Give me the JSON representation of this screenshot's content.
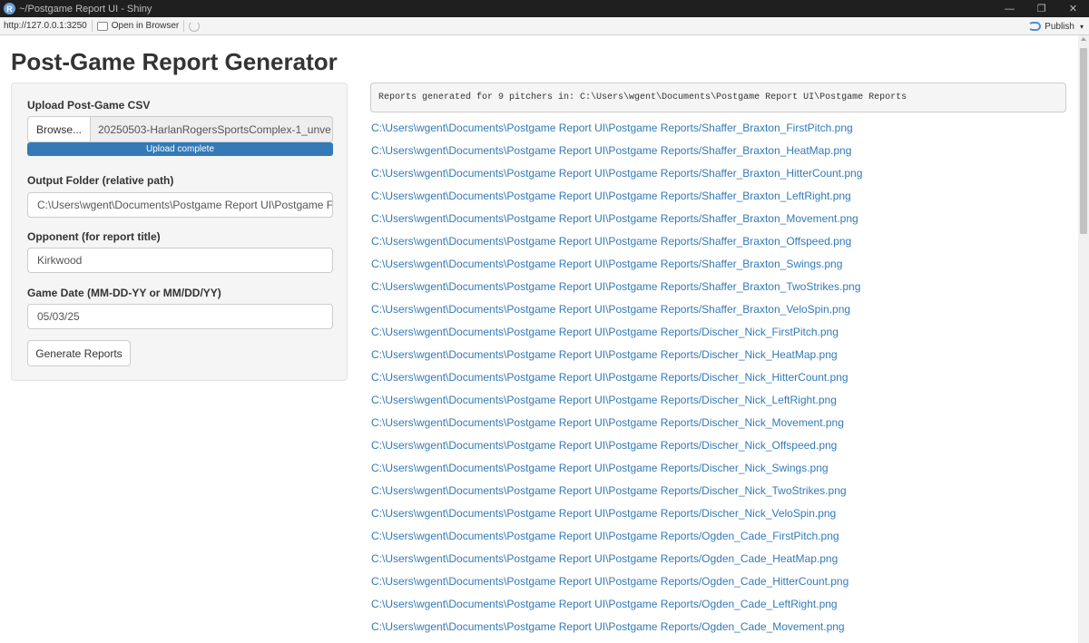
{
  "window": {
    "app_icon_letter": "R",
    "title": "~/Postgame Report UI - Shiny",
    "controls": [
      "—",
      "❐",
      "✕"
    ]
  },
  "toolbar": {
    "url": "http://127.0.0.1:3250",
    "open_in_browser": "Open in Browser",
    "publish": "Publish",
    "publish_caret": "▾"
  },
  "page": {
    "title": "Post-Game Report Generator"
  },
  "sidebar": {
    "upload_label": "Upload Post-Game CSV",
    "browse_label": "Browse...",
    "file_name": "20250503-HarlanRogersSportsComplex-1_unve",
    "upload_progress_text": "Upload complete",
    "upload_progress": 1.0,
    "output_label": "Output Folder (relative path)",
    "output_value": "C:\\Users\\wgent\\Documents\\Postgame Report UI\\Postgame F",
    "opponent_label": "Opponent (for report title)",
    "opponent_value": "Kirkwood",
    "date_label": "Game Date (MM-DD-YY or MM/DD/YY)",
    "date_value": "05/03/25",
    "generate_label": "Generate Reports"
  },
  "main": {
    "status_text": "Reports generated for 9 pitchers in: C:\\Users\\wgent\\Documents\\Postgame Report UI\\Postgame Reports",
    "links": [
      "C:\\Users\\wgent\\Documents\\Postgame Report UI\\Postgame Reports/Shaffer_Braxton_FirstPitch.png",
      "C:\\Users\\wgent\\Documents\\Postgame Report UI\\Postgame Reports/Shaffer_Braxton_HeatMap.png",
      "C:\\Users\\wgent\\Documents\\Postgame Report UI\\Postgame Reports/Shaffer_Braxton_HitterCount.png",
      "C:\\Users\\wgent\\Documents\\Postgame Report UI\\Postgame Reports/Shaffer_Braxton_LeftRight.png",
      "C:\\Users\\wgent\\Documents\\Postgame Report UI\\Postgame Reports/Shaffer_Braxton_Movement.png",
      "C:\\Users\\wgent\\Documents\\Postgame Report UI\\Postgame Reports/Shaffer_Braxton_Offspeed.png",
      "C:\\Users\\wgent\\Documents\\Postgame Report UI\\Postgame Reports/Shaffer_Braxton_Swings.png",
      "C:\\Users\\wgent\\Documents\\Postgame Report UI\\Postgame Reports/Shaffer_Braxton_TwoStrikes.png",
      "C:\\Users\\wgent\\Documents\\Postgame Report UI\\Postgame Reports/Shaffer_Braxton_VeloSpin.png",
      "C:\\Users\\wgent\\Documents\\Postgame Report UI\\Postgame Reports/Discher_Nick_FirstPitch.png",
      "C:\\Users\\wgent\\Documents\\Postgame Report UI\\Postgame Reports/Discher_Nick_HeatMap.png",
      "C:\\Users\\wgent\\Documents\\Postgame Report UI\\Postgame Reports/Discher_Nick_HitterCount.png",
      "C:\\Users\\wgent\\Documents\\Postgame Report UI\\Postgame Reports/Discher_Nick_LeftRight.png",
      "C:\\Users\\wgent\\Documents\\Postgame Report UI\\Postgame Reports/Discher_Nick_Movement.png",
      "C:\\Users\\wgent\\Documents\\Postgame Report UI\\Postgame Reports/Discher_Nick_Offspeed.png",
      "C:\\Users\\wgent\\Documents\\Postgame Report UI\\Postgame Reports/Discher_Nick_Swings.png",
      "C:\\Users\\wgent\\Documents\\Postgame Report UI\\Postgame Reports/Discher_Nick_TwoStrikes.png",
      "C:\\Users\\wgent\\Documents\\Postgame Report UI\\Postgame Reports/Discher_Nick_VeloSpin.png",
      "C:\\Users\\wgent\\Documents\\Postgame Report UI\\Postgame Reports/Ogden_Cade_FirstPitch.png",
      "C:\\Users\\wgent\\Documents\\Postgame Report UI\\Postgame Reports/Ogden_Cade_HeatMap.png",
      "C:\\Users\\wgent\\Documents\\Postgame Report UI\\Postgame Reports/Ogden_Cade_HitterCount.png",
      "C:\\Users\\wgent\\Documents\\Postgame Report UI\\Postgame Reports/Ogden_Cade_LeftRight.png",
      "C:\\Users\\wgent\\Documents\\Postgame Report UI\\Postgame Reports/Ogden_Cade_Movement.png"
    ]
  },
  "colors": {
    "link": "#337ab7",
    "progress": "#337ab7",
    "panel_bg": "#f5f5f5"
  }
}
